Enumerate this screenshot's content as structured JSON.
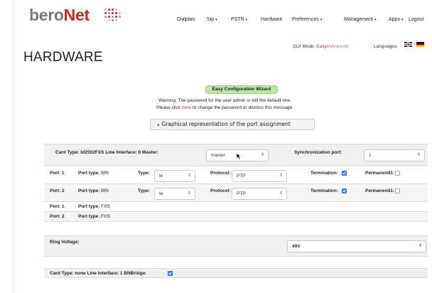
{
  "brand": {
    "part1": "bero",
    "part2": "Net"
  },
  "nav": {
    "items": [
      {
        "label": "Dialplan",
        "dropdown": false
      },
      {
        "label": "Sip",
        "dropdown": true
      },
      {
        "label": "PSTN",
        "dropdown": true
      },
      {
        "label": "Hardware",
        "dropdown": false
      },
      {
        "label": "Preferences",
        "dropdown": true
      },
      {
        "label": "Management",
        "dropdown": true
      },
      {
        "label": "Apps",
        "dropdown": true
      },
      {
        "label": "Logout",
        "dropdown": false
      }
    ],
    "caret": "▾"
  },
  "gui_mode": {
    "label": "GUI Mode:",
    "easy": "Easy",
    "separator": "/",
    "advanced": "Advanced"
  },
  "languages": {
    "label": "Languages:"
  },
  "page_title": "HARDWARE",
  "wizard_label": "Easy Configuration Wizard",
  "warning": {
    "line1": "Warning: The password for the user admin is still the default one.",
    "pre": "Please click",
    "link": "here",
    "post": "to change the password or dismiss this message."
  },
  "graph_button": {
    "icon": "▸",
    "label": "Graphical representation of the port assignment"
  },
  "card1": {
    "header": "Card Type: bf2502FXS  Line Interface: 0  Master:",
    "master_value": "master",
    "sync_label": "Synchronization port:",
    "sync_value": "1"
  },
  "port_rows": [
    {
      "port": "Port: 1",
      "port_type_label": "Port type:",
      "port_type": "BRI",
      "type_label": "Type:",
      "type_value": "te",
      "protocol_label": "Protocol:",
      "protocol_value": "PTP",
      "termination_label": "Termination:",
      "termination": true,
      "permanent_label": "PermanentI1:",
      "permanent": false
    },
    {
      "port": "Port: 2",
      "port_type_label": "Port type:",
      "port_type": "BRI",
      "type_label": "Type:",
      "type_value": "te",
      "protocol_label": "Protocol:",
      "protocol_value": "PTP",
      "termination_label": "Termination:",
      "termination": true,
      "permanent_label": "PermanentI1:",
      "permanent": false
    }
  ],
  "fxs_rows": [
    {
      "port": "Port: 1",
      "port_type_label": "Port type:",
      "port_type": "FXS"
    },
    {
      "port": "Port: 2",
      "port_type_label": "Port type:",
      "port_type": "FXS"
    }
  ],
  "ring_voltage": {
    "label": "Ring Voltage:",
    "value": "49V"
  },
  "card2": {
    "header": "Card Type: none  Line Interface: 1  BNBridge:",
    "bnbridge": true
  },
  "select_arrow": "⇕",
  "colors": {
    "brand_red": "#c62828",
    "brand_gray": "#7a7a7a",
    "wizard_green": "#bce6a3",
    "checkbox_blue": "#3b82f6"
  }
}
